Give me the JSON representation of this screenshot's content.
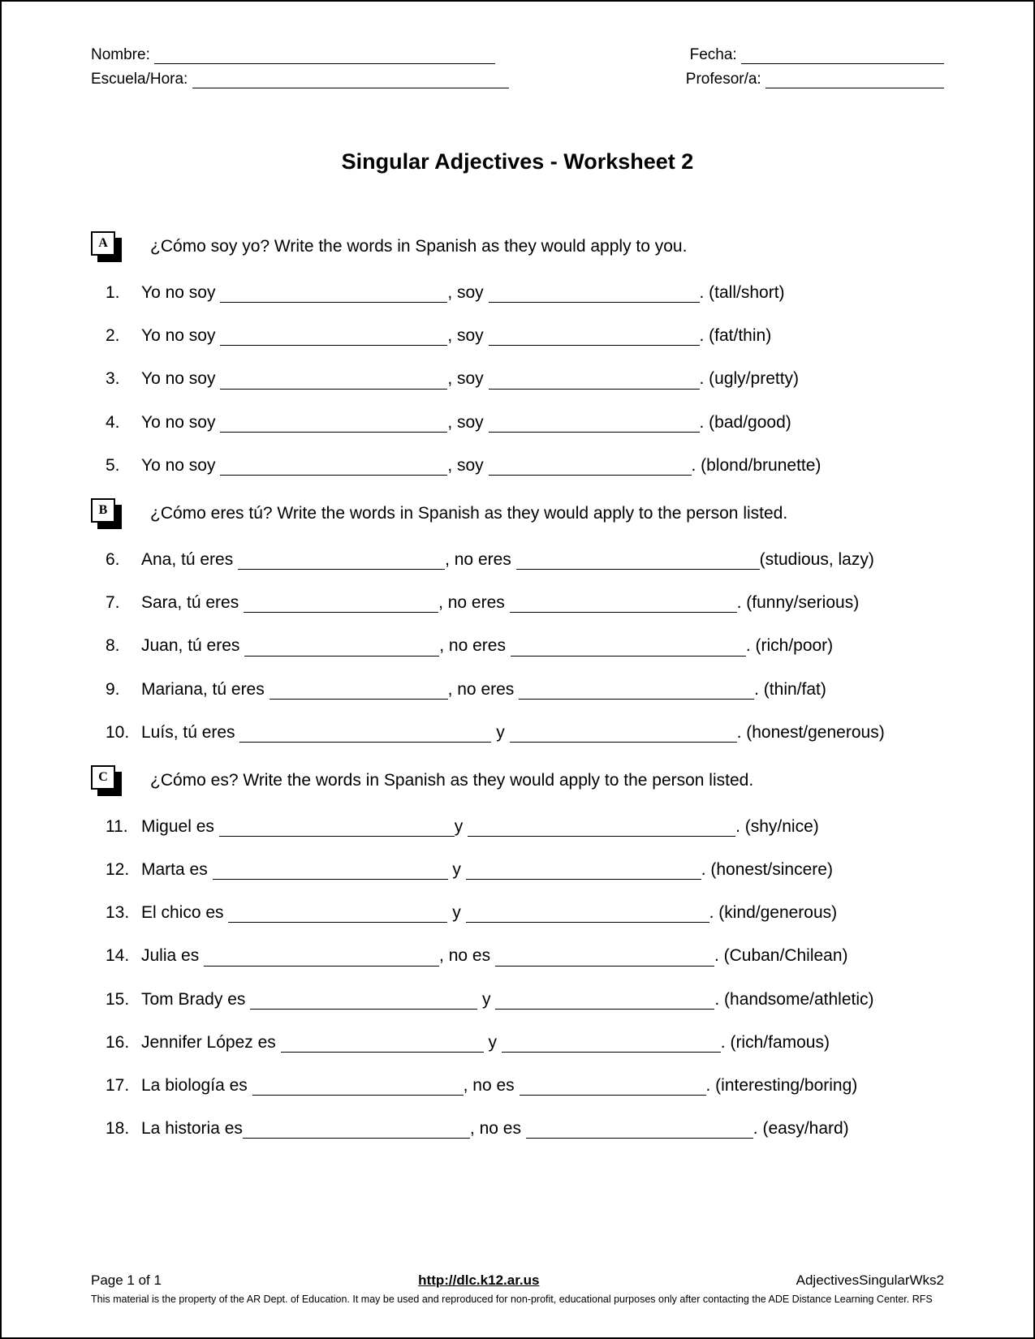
{
  "header": {
    "nombre_label": "Nombre:",
    "fecha_label": "Fecha:",
    "escuela_label": "Escuela/Hora:",
    "profesor_label": "Profesor/a:"
  },
  "title": "Singular Adjectives - Worksheet 2",
  "sections": {
    "a": {
      "letter": "A",
      "prompt": "¿Cómo soy yo?  Write the words in Spanish as they would apply to you.",
      "items": [
        {
          "n": "1.",
          "pre": "Yo no soy ",
          "mid": ", soy ",
          "hint": ". (tall/short)"
        },
        {
          "n": "2.",
          "pre": "Yo no soy ",
          "mid": ",  soy ",
          "hint": ". (fat/thin)"
        },
        {
          "n": "3.",
          "pre": "Yo no soy ",
          "mid": ", soy ",
          "hint": ". (ugly/pretty)"
        },
        {
          "n": "4.",
          "pre": "Yo no soy ",
          "mid": ", soy ",
          "hint": ". (bad/good)"
        },
        {
          "n": "5.",
          "pre": "Yo no soy ",
          "mid": ", soy ",
          "hint": ". (blond/brunette)"
        }
      ]
    },
    "b": {
      "letter": "B",
      "prompt": "¿Cómo eres tú?  Write the words in Spanish as they would apply to the person listed.",
      "items": [
        {
          "n": "6.",
          "pre": "Ana, tú eres ",
          "mid": ", no eres ",
          "hint": "(studious, lazy)"
        },
        {
          "n": "7.",
          "pre": "Sara, tú eres ",
          "mid": ", no eres ",
          "hint": ". (funny/serious)"
        },
        {
          "n": "8.",
          "pre": "Juan, tú eres ",
          "mid": ", no eres ",
          "hint": ". (rich/poor)"
        },
        {
          "n": "9.",
          "pre": "Mariana, tú eres ",
          "mid": ", no eres ",
          "hint": ". (thin/fat)"
        },
        {
          "n": "10.",
          "pre": "Luís, tú eres ",
          "mid": " y ",
          "hint": ". (honest/generous)"
        }
      ]
    },
    "c": {
      "letter": "C",
      "prompt": "¿Cómo es?  Write the words in Spanish as they would apply to the person listed.",
      "items": [
        {
          "n": "11.",
          "pre": "Miguel es ",
          "mid": "y ",
          "hint": ". (shy/nice)"
        },
        {
          "n": "12.",
          "pre": "Marta es ",
          "mid": " y ",
          "hint": ". (honest/sincere)"
        },
        {
          "n": "13.",
          "pre": "El chico es ",
          "mid": " y ",
          "hint": ". (kind/generous)"
        },
        {
          "n": "14.",
          "pre": "Julia es ",
          "mid": ", no es ",
          "hint": ". (Cuban/Chilean)"
        },
        {
          "n": "15.",
          "pre": "Tom Brady es ",
          "mid": " y ",
          "hint": ". (handsome/athletic)"
        },
        {
          "n": "16.",
          "pre": "Jennifer López es ",
          "mid": " y ",
          "hint": ". (rich/famous)"
        },
        {
          "n": "17.",
          "pre": "La biología es ",
          "mid": ", no es ",
          "hint": ". (interesting/boring)"
        },
        {
          "n": "18.",
          "pre": "La historia es",
          "mid": ", no es ",
          "hint": ".  (easy/hard)"
        }
      ]
    }
  },
  "footer": {
    "page": "Page 1 of 1",
    "url": "http://dlc.k12.ar.us",
    "doc": "AdjectivesSingularWks2",
    "copy": "This material is the property of the AR Dept. of Education.  It may be used and reproduced for non-profit, educational purposes only after contacting the ADE Distance Learning Center. RFS"
  },
  "blanks": {
    "a": [
      280,
      260,
      280,
      260,
      280,
      260,
      280,
      260,
      280,
      250
    ],
    "b": [
      255,
      300,
      240,
      280,
      240,
      290,
      220,
      290,
      310,
      280
    ],
    "c": [
      290,
      330,
      290,
      290,
      270,
      300,
      290,
      270,
      280,
      270,
      250,
      270,
      260,
      230,
      280,
      280
    ]
  }
}
